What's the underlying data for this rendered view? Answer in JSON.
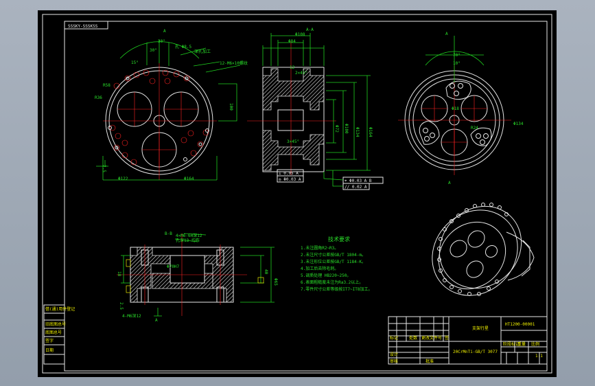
{
  "drawing": {
    "code_box": "SSSKY-SSSKSS",
    "section_a": "A",
    "section_aa": "A-A",
    "section_bb": "B-B",
    "tech_title": "技术要求",
    "tech_notes": [
      "1.未注圆角R2~R3。",
      "2.未注尺寸公差按GB/T 1804-m。",
      "3.未注形位公差按GB/T 1184-K。",
      "4.加工后去除毛刺。",
      "5.调质处理 HB220~250。",
      "6.表面粗糙度未注为Ra3.2以上。",
      "7.零件尺寸公差等级按IT7~IT8加工。"
    ]
  },
  "title_block": {
    "part_name": "支架行星",
    "drawing_no": "HT1200-00001",
    "material": "20CrMnTi-GB/T 3077",
    "scale": "1:1"
  },
  "side_table": {
    "rows": [
      "借(通)用件登记",
      "",
      "旧底图总号",
      "底图总号",
      "签字",
      "日期"
    ]
  }
}
